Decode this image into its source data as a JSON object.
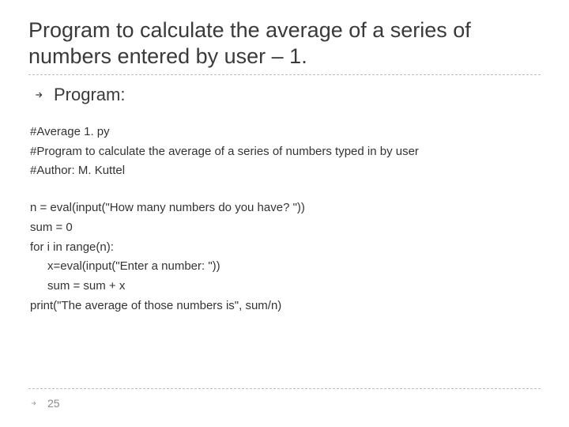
{
  "title": "Program to calculate the average of a series of numbers entered by user – 1.",
  "bullet": {
    "label": "Program:"
  },
  "code": {
    "l1": "#Average 1. py",
    "l2": "#Program to calculate the average of a series of numbers typed in by user",
    "l3": "#Author: M. Kuttel",
    "l4": "n = eval(input(\"How many numbers do you have? \"))",
    "l5": "sum = 0",
    "l6": "for i in range(n):",
    "l7": "x=eval(input(\"Enter a number: \"))",
    "l8": "sum = sum + x",
    "l9": "print(\"The average of those numbers is\", sum/n)"
  },
  "footer": {
    "page": "25"
  }
}
